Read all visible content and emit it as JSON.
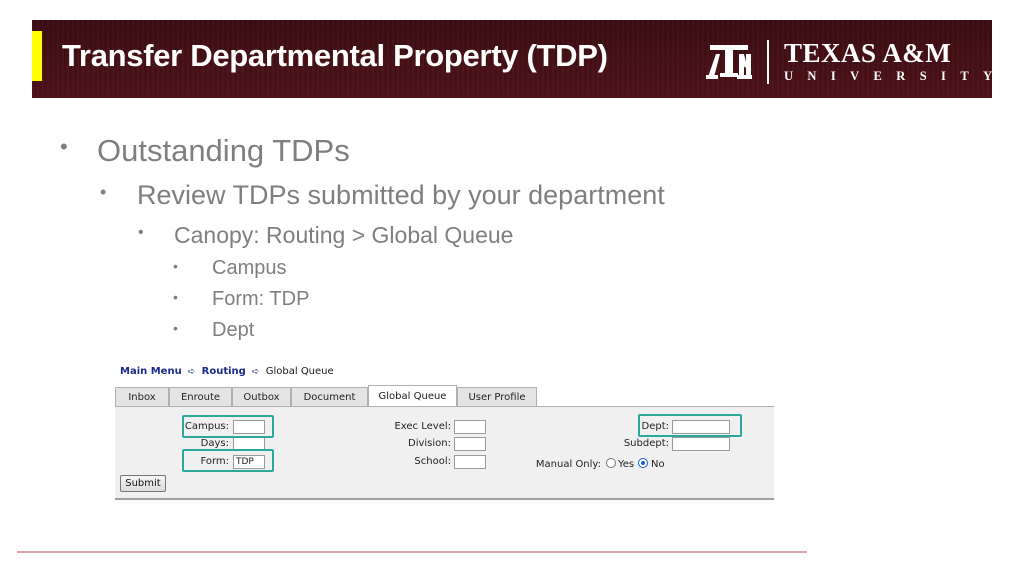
{
  "slide": {
    "title": "Transfer Departmental Property (TDP)",
    "logo": {
      "wordmark_line1": "TEXAS A&M",
      "wordmark_line2": "UNIVERSITY",
      "mark": "ATM"
    },
    "bullets": {
      "l1": "Outstanding TDPs",
      "l2": "Review TDPs submitted by your department",
      "l3": "Canopy: Routing > Global Queue",
      "l4": [
        "Campus",
        "Form: TDP",
        "Dept"
      ]
    },
    "colors": {
      "banner": "#4e1219",
      "accent_bar": "#ffff00",
      "highlight": "#2ba89a",
      "footer_line": "#d9a3aa"
    }
  },
  "app": {
    "breadcrumb": {
      "main_menu": "Main Menu",
      "routing": "Routing",
      "current": "Global Queue",
      "separator_icon": "arrow-right-icon"
    },
    "tabs": [
      {
        "label": "Inbox"
      },
      {
        "label": "Enroute"
      },
      {
        "label": "Outbox"
      },
      {
        "label": "Document"
      },
      {
        "label": "Global Queue"
      },
      {
        "label": "User Profile"
      }
    ],
    "form": {
      "campus_label": "Campus:",
      "campus_value": "",
      "days_label": "Days:",
      "days_value": "",
      "form_label": "Form:",
      "form_value": "TDP",
      "exec_level_label": "Exec Level:",
      "exec_level_value": "",
      "division_label": "Division:",
      "division_value": "",
      "school_label": "School:",
      "school_value": "",
      "dept_label": "Dept:",
      "dept_value": "",
      "subdept_label": "Subdept:",
      "subdept_value": "",
      "manual_only_label": "Manual Only:",
      "yes_label": "Yes",
      "no_label": "No",
      "manual_only_selected": "No"
    },
    "submit_label": "Submit"
  }
}
